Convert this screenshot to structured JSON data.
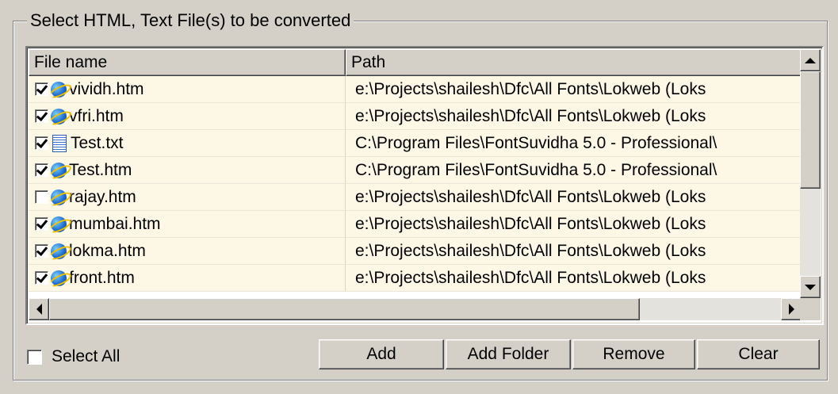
{
  "group_title": "Select HTML, Text File(s) to be converted",
  "columns": {
    "file_name": "File name",
    "path": "Path"
  },
  "files": [
    {
      "checked": true,
      "type": "htm",
      "name": "vividh.htm",
      "path": "e:\\Projects\\shailesh\\Dfc\\All Fonts\\Lokweb (Loks"
    },
    {
      "checked": true,
      "type": "htm",
      "name": "vfri.htm",
      "path": "e:\\Projects\\shailesh\\Dfc\\All Fonts\\Lokweb (Loks"
    },
    {
      "checked": true,
      "type": "txt",
      "name": "Test.txt",
      "path": "C:\\Program Files\\FontSuvidha 5.0 - Professional\\"
    },
    {
      "checked": true,
      "type": "htm",
      "name": "Test.htm",
      "path": "C:\\Program Files\\FontSuvidha 5.0 - Professional\\"
    },
    {
      "checked": false,
      "type": "htm",
      "name": "rajay.htm",
      "path": "e:\\Projects\\shailesh\\Dfc\\All Fonts\\Lokweb (Loks"
    },
    {
      "checked": true,
      "type": "htm",
      "name": "mumbai.htm",
      "path": "e:\\Projects\\shailesh\\Dfc\\All Fonts\\Lokweb (Loks"
    },
    {
      "checked": true,
      "type": "htm",
      "name": "lokma.htm",
      "path": "e:\\Projects\\shailesh\\Dfc\\All Fonts\\Lokweb (Loks"
    },
    {
      "checked": true,
      "type": "htm",
      "name": "front.htm",
      "path": "e:\\Projects\\shailesh\\Dfc\\All Fonts\\Lokweb (Loks"
    }
  ],
  "select_all": {
    "label": "Select All",
    "checked": false
  },
  "buttons": {
    "add": "Add",
    "add_folder": "Add Folder",
    "remove": "Remove",
    "clear": "Clear"
  },
  "icons": {
    "htm": "ie-globe-icon",
    "txt": "text-file-icon"
  }
}
